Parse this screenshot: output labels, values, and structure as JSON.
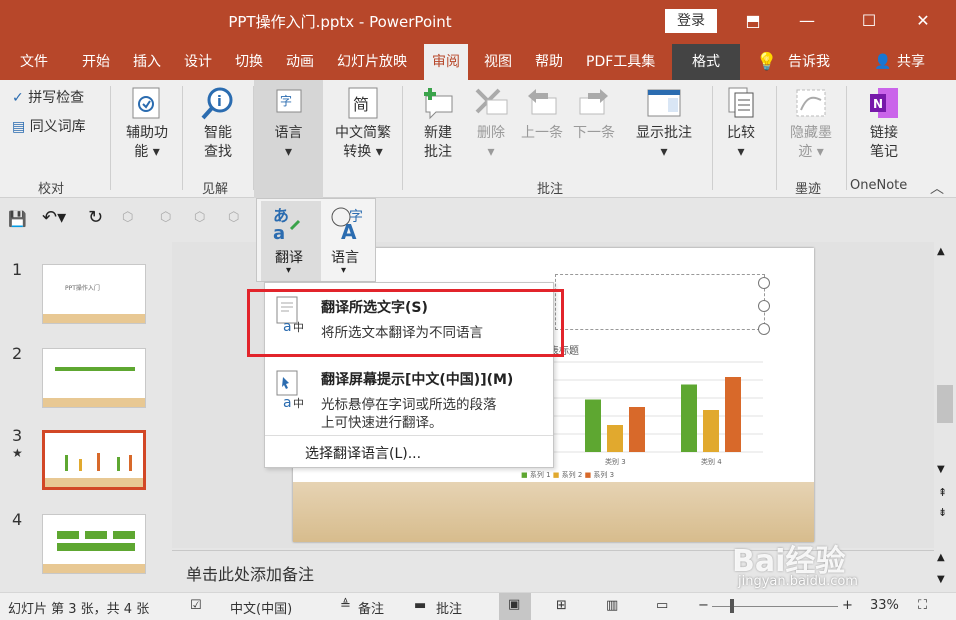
{
  "titlebar": {
    "title": "PPT操作入门.pptx  -  PowerPoint",
    "login": "登录"
  },
  "menu": [
    "文件",
    "开始",
    "插入",
    "设计",
    "切换",
    "动画",
    "幻灯片放映",
    "审阅",
    "视图",
    "帮助",
    "PDF工具集",
    "格式"
  ],
  "menu_right": {
    "tell": "告诉我",
    "share": "共享"
  },
  "ribbon": {
    "spell": "拼写检查",
    "thesaurus": "同义词库",
    "group_proof": "校对",
    "access": [
      "辅助功",
      "能"
    ],
    "smart": [
      "智能",
      "查找"
    ],
    "group_insight": "见解",
    "language": [
      "语言"
    ],
    "tcsc": [
      "中文简繁",
      "转换"
    ],
    "new_comment": [
      "新建",
      "批注"
    ],
    "delete": "删除",
    "prev": "上一条",
    "next": "下一条",
    "show_comments": "显示批注",
    "group_comments": "批注",
    "compare": "比较",
    "hide_ink": [
      "隐藏墨",
      "迹"
    ],
    "group_ink": "墨迹",
    "link_notes": [
      "链接",
      "笔记"
    ],
    "group_onenote": "OneNote"
  },
  "lang_pop": {
    "translate": "翻译",
    "language": "语言"
  },
  "dropdown": {
    "item1": {
      "title": "翻译所选文字(S)",
      "desc": "将所选文本翻译为不同语言"
    },
    "item2": {
      "title": "翻译屏幕提示[中文(中国)](M)",
      "desc1": "光标悬停在字词或所选的段落",
      "desc2": "上可快速进行翻译。"
    },
    "item3": "选择翻译语言(L)..."
  },
  "thumbs": [
    {
      "n": "1",
      "label": "PPT操作入门"
    },
    {
      "n": "2"
    },
    {
      "n": "3",
      "star": "★"
    },
    {
      "n": "4"
    }
  ],
  "slide": {
    "chart_title": "表标题",
    "cats": [
      "类别 3",
      "类别 4"
    ],
    "legend": [
      "系列 1",
      "系列 2",
      "系列 3"
    ]
  },
  "chart_data": {
    "type": "bar",
    "categories": [
      "类别 3",
      "类别 4"
    ],
    "series": [
      {
        "name": "系列 1",
        "values": [
          3.5,
          4.5
        ]
      },
      {
        "name": "系列 2",
        "values": [
          1.8,
          2.8
        ]
      },
      {
        "name": "系列 3",
        "values": [
          3.0,
          5.0
        ]
      }
    ],
    "title": "表标题"
  },
  "notes": "单击此处添加备注",
  "status": {
    "slide": "幻灯片 第 3 张，共 4 张",
    "lang": "中文(中国)",
    "notes": "备注",
    "comments": "批注",
    "zoom": "33%"
  },
  "watermark": {
    "brand": "Bai经验",
    "url": "jingyan.baidu.com"
  },
  "colors": {
    "accent": "#b7472a",
    "s1": "#5ea731",
    "s2": "#e1a92e",
    "s3": "#d8692a"
  }
}
